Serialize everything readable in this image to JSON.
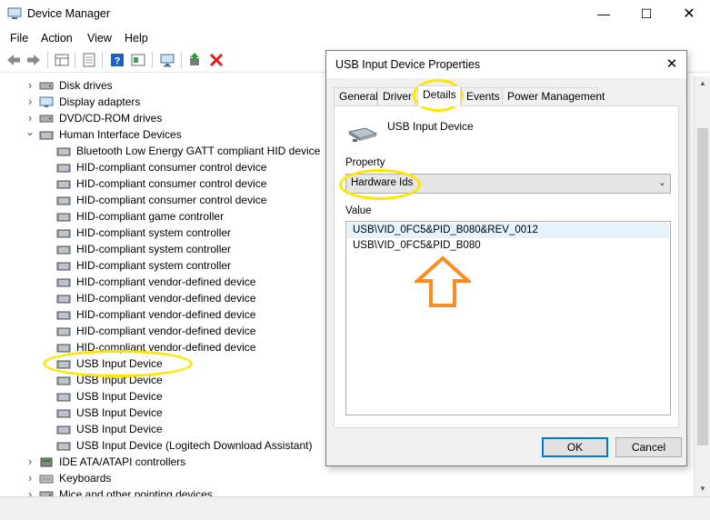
{
  "window": {
    "title": "Device Manager",
    "minimize": "—",
    "maximize": "☐",
    "close": "✕"
  },
  "menu": [
    "File",
    "Action",
    "View",
    "Help"
  ],
  "toolbar": {
    "icons": [
      "back-arrow-icon",
      "forward-arrow-icon",
      "properties-grid-icon",
      "show-hidden-icon",
      "help-icon",
      "view-devices-icon",
      "monitor-icon",
      "update-driver-icon",
      "uninstall-red-x-icon"
    ]
  },
  "tree": [
    {
      "label": "Disk drives",
      "level": 1,
      "expander": "›",
      "icon": "disk-drive-icon"
    },
    {
      "label": "Display adapters",
      "level": 1,
      "expander": "›",
      "icon": "display-adapter-icon"
    },
    {
      "label": "DVD/CD-ROM drives",
      "level": 1,
      "expander": "›",
      "icon": "dvd-drive-icon"
    },
    {
      "label": "Human Interface Devices",
      "level": 1,
      "expander": "⌄",
      "icon": "hid-icon"
    },
    {
      "label": "Bluetooth Low Energy GATT compliant HID device",
      "level": 2,
      "icon": "hid-device-icon"
    },
    {
      "label": "HID-compliant consumer control device",
      "level": 2,
      "icon": "hid-device-icon"
    },
    {
      "label": "HID-compliant consumer control device",
      "level": 2,
      "icon": "hid-device-icon"
    },
    {
      "label": "HID-compliant consumer control device",
      "level": 2,
      "icon": "hid-device-icon"
    },
    {
      "label": "HID-compliant game controller",
      "level": 2,
      "icon": "hid-device-icon"
    },
    {
      "label": "HID-compliant system controller",
      "level": 2,
      "icon": "hid-device-icon"
    },
    {
      "label": "HID-compliant system controller",
      "level": 2,
      "icon": "hid-device-icon"
    },
    {
      "label": "HID-compliant system controller",
      "level": 2,
      "icon": "hid-device-icon"
    },
    {
      "label": "HID-compliant vendor-defined device",
      "level": 2,
      "icon": "hid-device-icon"
    },
    {
      "label": "HID-compliant vendor-defined device",
      "level": 2,
      "icon": "hid-device-icon"
    },
    {
      "label": "HID-compliant vendor-defined device",
      "level": 2,
      "icon": "hid-device-icon"
    },
    {
      "label": "HID-compliant vendor-defined device",
      "level": 2,
      "icon": "hid-device-icon"
    },
    {
      "label": "HID-compliant vendor-defined device",
      "level": 2,
      "icon": "hid-device-icon"
    },
    {
      "label": "USB Input Device",
      "level": 2,
      "icon": "hid-device-icon",
      "selected": true
    },
    {
      "label": "USB Input Device",
      "level": 2,
      "icon": "hid-device-icon"
    },
    {
      "label": "USB Input Device",
      "level": 2,
      "icon": "hid-device-icon"
    },
    {
      "label": "USB Input Device",
      "level": 2,
      "icon": "hid-device-icon"
    },
    {
      "label": "USB Input Device",
      "level": 2,
      "icon": "hid-device-icon"
    },
    {
      "label": "USB Input Device (Logitech Download Assistant)",
      "level": 2,
      "icon": "hid-device-icon"
    },
    {
      "label": "IDE ATA/ATAPI controllers",
      "level": 1,
      "expander": "›",
      "icon": "ide-controller-icon"
    },
    {
      "label": "Keyboards",
      "level": 1,
      "expander": "›",
      "icon": "keyboard-icon"
    },
    {
      "label": "Mice and other pointing devices",
      "level": 1,
      "expander": "›",
      "icon": "mouse-icon"
    }
  ],
  "dialog": {
    "title": "USB Input Device Properties",
    "close": "✕",
    "tabs": [
      "General",
      "Driver",
      "Details",
      "Events",
      "Power Management"
    ],
    "active_tab": "Details",
    "device_name": "USB Input Device",
    "property_label": "Property",
    "property_value": "Hardware Ids",
    "value_label": "Value",
    "values": [
      "USB\\VID_0FC5&PID_B080&REV_0012",
      "USB\\VID_0FC5&PID_B080"
    ],
    "ok": "OK",
    "cancel": "Cancel"
  },
  "colors": {
    "highlight_ring": "#ffe600",
    "arrow": "#ff8a1f",
    "selection": "#e5f1fb",
    "default_button_border": "#0078d7"
  }
}
